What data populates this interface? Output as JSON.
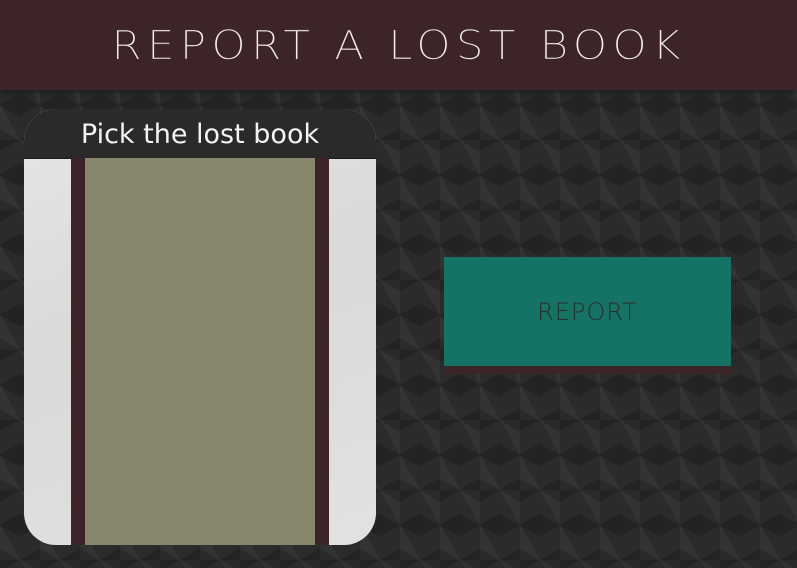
{
  "header": {
    "title": "REPORT A LOST BOOK"
  },
  "picker": {
    "title": "Pick the lost book",
    "selected_item": {
      "label": ""
    }
  },
  "actions": {
    "report_label": "REPORT"
  },
  "colors": {
    "header_bg": "#3d2428",
    "page_bg": "#2b2b2b",
    "picker_bg": "#dcdcdc",
    "picker_header_bg": "#2a2a2a",
    "list_accent": "#3d2428",
    "list_item_bg": "#88876e",
    "report_button_bg": "#157365"
  }
}
